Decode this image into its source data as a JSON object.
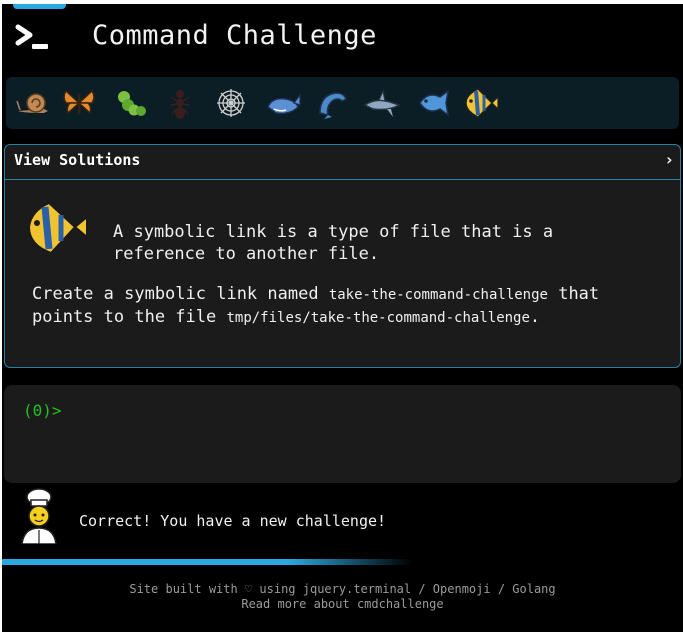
{
  "header": {
    "title": "Command Challenge",
    "logo_icon": "terminal-prompt-icon"
  },
  "levels": [
    {
      "name": "snail-icon"
    },
    {
      "name": "butterfly-icon"
    },
    {
      "name": "caterpillar-icon"
    },
    {
      "name": "ant-icon"
    },
    {
      "name": "spider-web-icon"
    },
    {
      "name": "whale-icon"
    },
    {
      "name": "dolphin-icon"
    },
    {
      "name": "shark-icon"
    },
    {
      "name": "fish-icon"
    },
    {
      "name": "tropical-fish-icon"
    }
  ],
  "solutions": {
    "title": "View Solutions",
    "chevron": "›",
    "description": "A symbolic link is a type of file that is a reference to another file.",
    "task_prefix": "Create a symbolic link named ",
    "task_link_name": "take-the-command-challenge",
    "task_middle": " that points to the file ",
    "task_target": "tmp/files/take-the-command-challenge",
    "task_suffix": "."
  },
  "terminal": {
    "prompt": "(0)>"
  },
  "status": {
    "message": "Correct! You have a new challenge!",
    "icon": "chef-icon"
  },
  "footer": {
    "line1": "Site built with ♡ using jquery.terminal / Openmoji / Golang",
    "line2": "Read more about cmdchallenge"
  },
  "colors": {
    "accent": "#2aa8e0",
    "prompt": "#22c022",
    "panel_bg": "#1b1b1b",
    "level_bar_bg": "#0b1e26"
  }
}
